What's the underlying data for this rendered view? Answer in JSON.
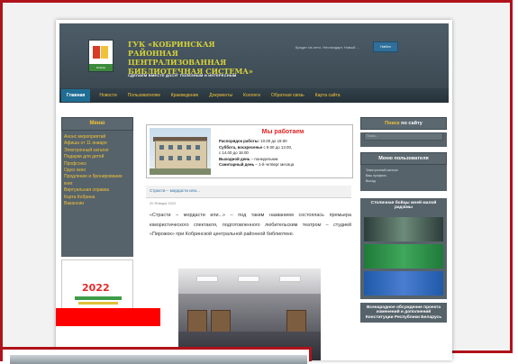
{
  "header": {
    "org_title": "ГУК «Кобринская районная централизованная библиотечная система»",
    "slogan": "СДЕЛАЕМ ВМЕСТЕ ДОСУГ ПОЛЕЗНЫМ И ИНТЕРЕСНЫМ",
    "search_label": "Кредит на лето. Нестандарт. Новый ...",
    "search_button": "Найти",
    "logo_caption": "Кобрин"
  },
  "nav": {
    "items": [
      "Главная",
      "Новости",
      "Пользователям",
      "Краеведение",
      "Документы",
      "Коллеги",
      "Обратная связь",
      "Карта сайта"
    ]
  },
  "left": {
    "menu_title": "Меню",
    "links": [
      "Анонс мероприятий",
      "Афиша от 11 января",
      "Электронный каталог",
      "Подарки для детей",
      "Профсоюз",
      "Одно окно",
      "Продление и бронирование книг",
      "Виртуальная справка",
      "Карта Кобрина",
      "Вакансии"
    ],
    "banner_year": "2022"
  },
  "work": {
    "title": "Мы работаем",
    "lines": [
      {
        "bold": "Распорядок работы:",
        "text": " 10.00 до 19.00"
      },
      {
        "bold": "Суббота, воскресенье",
        "text": " с 9.00 до 13.00,"
      },
      {
        "bold": "",
        "text": "с 14.00 до 18.00"
      },
      {
        "bold": "Выходной день",
        "text": " – понедельник"
      },
      {
        "bold": "Санитарный день",
        "text": " – 1-й четверг месяца"
      }
    ]
  },
  "article": {
    "title": "Страсти – мордасти или...",
    "date": "20 Января 2022",
    "text": "«Страсти – мордасти или...» – под таким названием состоялась премьера юмористического спектакля, подготовленного любительским театром – студией «Пирожок» при Кобринской центральной районной библиотеке."
  },
  "right": {
    "search_title_a": "Поиск",
    "search_title_b": " по сайту",
    "search_placeholder": "Поиск...",
    "users_title_a": "Меню",
    "users_title_b": " пользователя",
    "users_links": [
      "Электронный каталог",
      "Ваш профиль",
      "Выход"
    ],
    "gallery_title_a": "Столичная",
    "gallery_title_b": " бойцы моей малой радзімы",
    "bottom_text_a": "Всенародное",
    "bottom_text_b": " обсуждение проекта изменений и дополнений Конституции Республики Беларусь"
  },
  "colors": {
    "accent_red": "#b0121b",
    "nav_gold": "#f2c13a",
    "header_dark": "#39464f",
    "link_blue": "#2b6ea3"
  }
}
